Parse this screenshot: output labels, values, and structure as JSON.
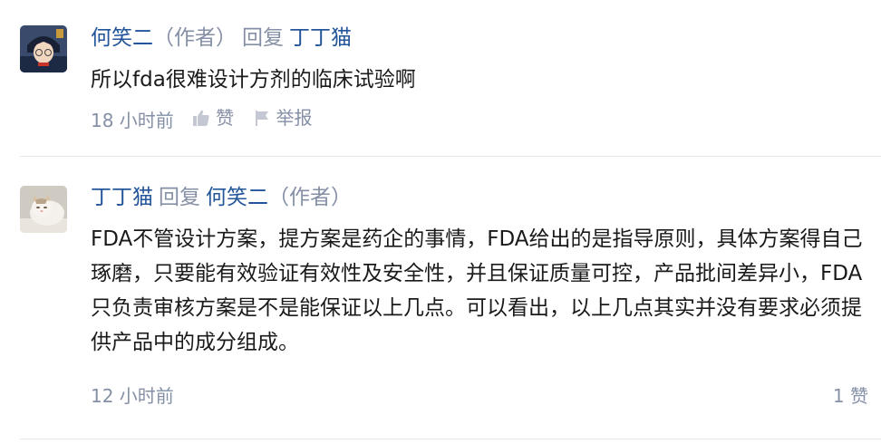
{
  "comments": [
    {
      "author": "何笑二",
      "author_tag": "（作者）",
      "reply_word": "回复",
      "reply_to": "丁丁猫",
      "reply_to_tag": "",
      "content": "所以fda很难设计方剂的临床试验啊",
      "time": "18 小时前",
      "like_label": "赞",
      "report_label": "举报",
      "avatar": "anime-character-avatar"
    },
    {
      "author": "丁丁猫",
      "author_tag": "",
      "reply_word": "回复",
      "reply_to": "何笑二",
      "reply_to_tag": "（作者）",
      "content": "FDA不管设计方案，提方案是药企的事情，FDA给出的是指导原则，具体方案得自己琢磨，只要能有效验证有效性及安全性，并且保证质量可控，产品批间差异小，FDA只负责审核方案是不是能保证以上几点。可以看出，以上几点其实并没有要求必须提供产品中的成分组成。",
      "time": "12 小时前",
      "likes_display": "1 赞",
      "avatar": "cat-avatar"
    }
  ],
  "colors": {
    "name": "#225599",
    "meta": "#8590a6",
    "text": "#1a1a1a",
    "divider": "#e7e7e7"
  }
}
